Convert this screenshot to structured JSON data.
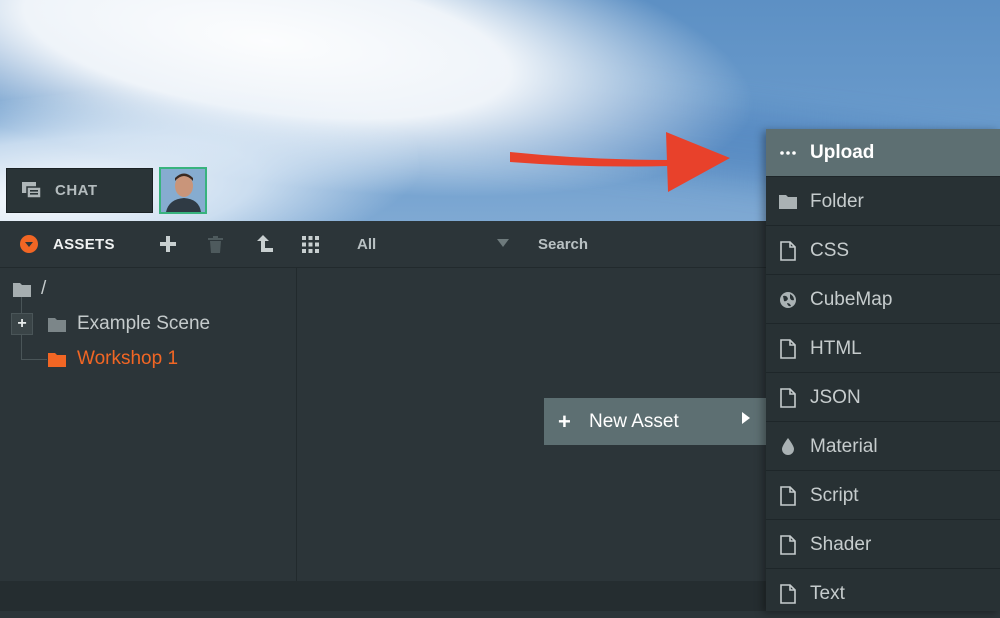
{
  "chat": {
    "label": "CHAT"
  },
  "assets_toolbar": {
    "title": "ASSETS",
    "filter_value": "All",
    "search_placeholder": "Search"
  },
  "tree": {
    "root": "/",
    "items": [
      {
        "label": "Example Scene",
        "active": false
      },
      {
        "label": "Workshop 1",
        "active": true
      }
    ]
  },
  "new_asset": {
    "label": "New Asset"
  },
  "menu": {
    "items": [
      {
        "label": "Upload",
        "icon": "ellipsis-icon"
      },
      {
        "label": "Folder",
        "icon": "folder-icon"
      },
      {
        "label": "CSS",
        "icon": "file-icon"
      },
      {
        "label": "CubeMap",
        "icon": "globe-icon"
      },
      {
        "label": "HTML",
        "icon": "file-icon"
      },
      {
        "label": "JSON",
        "icon": "file-icon"
      },
      {
        "label": "Material",
        "icon": "droplet-icon"
      },
      {
        "label": "Script",
        "icon": "file-icon"
      },
      {
        "label": "Shader",
        "icon": "file-icon"
      },
      {
        "label": "Text",
        "icon": "file-icon"
      }
    ]
  },
  "colors": {
    "accent": "#f26624",
    "panel": "#2c3539",
    "menu_highlight": "#5d6f72",
    "arrow": "#e8412b",
    "avatar_border": "#38b37e"
  }
}
